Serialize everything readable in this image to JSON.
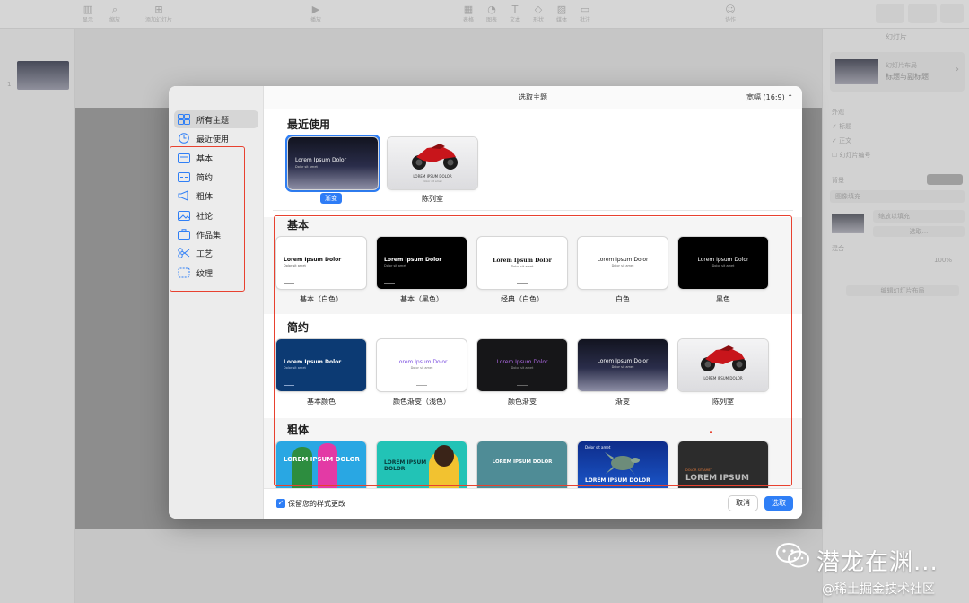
{
  "toolbar": {
    "items": [
      {
        "label": "显示",
        "icon": "view-icon"
      },
      {
        "label": "缩放",
        "icon": "zoom-icon"
      },
      {
        "label": "添加幻灯片",
        "icon": "add-slide-icon"
      },
      {
        "label": "播放",
        "icon": "play-icon"
      },
      {
        "label": "表格",
        "icon": "table-icon"
      },
      {
        "label": "图表",
        "icon": "chart-icon"
      },
      {
        "label": "文本",
        "icon": "text-icon"
      },
      {
        "label": "形状",
        "icon": "shape-icon"
      },
      {
        "label": "媒体",
        "icon": "media-icon"
      },
      {
        "label": "批注",
        "icon": "comment-icon"
      },
      {
        "label": "协作",
        "icon": "collaborate-icon"
      }
    ]
  },
  "navigator": {
    "slide_number": "1"
  },
  "inspector": {
    "tab": "幻灯片",
    "layout_name": "幻灯片布局",
    "layout_value": "标题与副标题",
    "appearance_heading": "外观",
    "check_title": "标题",
    "check_body": "正文",
    "check_slide_number": "幻灯片编号",
    "background_label": "背景",
    "fill_type": "图像填充",
    "scale_mode": "缩放以填充",
    "choose_button": "选取...",
    "blend_label": "混合",
    "opacity": "100%",
    "edit_layout_button": "编辑幻灯片布局"
  },
  "dialog": {
    "title": "选取主题",
    "aspect": "宽幅 (16:9)",
    "sidebar": [
      {
        "label": "所有主题",
        "icon": "all-themes-icon"
      },
      {
        "label": "最近使用",
        "icon": "recent-clock-icon"
      },
      {
        "label": "基本",
        "icon": "basic-icon"
      },
      {
        "label": "简约",
        "icon": "minimal-icon"
      },
      {
        "label": "粗体",
        "icon": "bold-megaphone-icon"
      },
      {
        "label": "社论",
        "icon": "editorial-image-icon"
      },
      {
        "label": "作品集",
        "icon": "portfolio-icon"
      },
      {
        "label": "工艺",
        "icon": "craft-scissors-icon"
      },
      {
        "label": "纹理",
        "icon": "texture-icon"
      }
    ],
    "recent": {
      "title": "最近使用",
      "themes": [
        {
          "label": "渐变",
          "card_title": "Lorem Ipsum Dolor",
          "card_sub": "Dolor sit amet"
        },
        {
          "label": "陈列室",
          "card_title": "LOREM IPSUM DOLOR",
          "card_sub": "Dolor sit amet"
        }
      ]
    },
    "basic": {
      "title": "基本",
      "themes": [
        {
          "label": "基本（白色）",
          "card_title": "Lorem Ipsum Dolor",
          "card_sub": "Dolor sit amet"
        },
        {
          "label": "基本（黑色）",
          "card_title": "Lorem Ipsum Dolor",
          "card_sub": "Dolor sit amet"
        },
        {
          "label": "经典（白色）",
          "card_title": "Lorem Ipsum Dolor",
          "card_sub": "Dolor sit amet"
        },
        {
          "label": "白色",
          "card_title": "Lorem Ipsum Dolor",
          "card_sub": "Dolor sit amet"
        },
        {
          "label": "黑色",
          "card_title": "Lorem Ipsum Dolor",
          "card_sub": "Dolor sit amet"
        }
      ]
    },
    "minimal": {
      "title": "简约",
      "themes": [
        {
          "label": "基本颜色",
          "card_title": "Lorem Ipsum Dolor",
          "card_sub": "Dolor sit amet"
        },
        {
          "label": "颜色渐变（浅色）",
          "card_title": "Lorem Ipsum Dolor",
          "card_sub": "Dolor sit amet"
        },
        {
          "label": "颜色渐变",
          "card_title": "Lorem Ipsum Dolor",
          "card_sub": "Dolor sit amet"
        },
        {
          "label": "渐变",
          "card_title": "Lorem Ipsum Dolor",
          "card_sub": "Dolor sit amet"
        },
        {
          "label": "陈列室",
          "card_title": "LOREM IPSUM DOLOR",
          "card_sub": ""
        }
      ]
    },
    "bold": {
      "title": "粗体",
      "themes": [
        {
          "card_title": "LOREM IPSUM DOLOR"
        },
        {
          "card_title": "LOREM IPSUM DOLOR"
        },
        {
          "card_title": "LOREM IPSUM DOLOR"
        },
        {
          "card_title": "LOREM IPSUM DOLOR",
          "card_sub": "Dolor sit amet"
        },
        {
          "card_title": "LOREM IPSUM",
          "card_sub": "DOLOR SIT AMET"
        }
      ]
    },
    "keep_changes": "保留您的样式更改",
    "cancel": "取消",
    "choose": "选取",
    "colors": {
      "accent": "#2f7ff6",
      "annotation": "#e8412f"
    }
  },
  "watermark": {
    "title": "潜龙在渊...",
    "subtitle": "@稀土掘金技术社区"
  }
}
